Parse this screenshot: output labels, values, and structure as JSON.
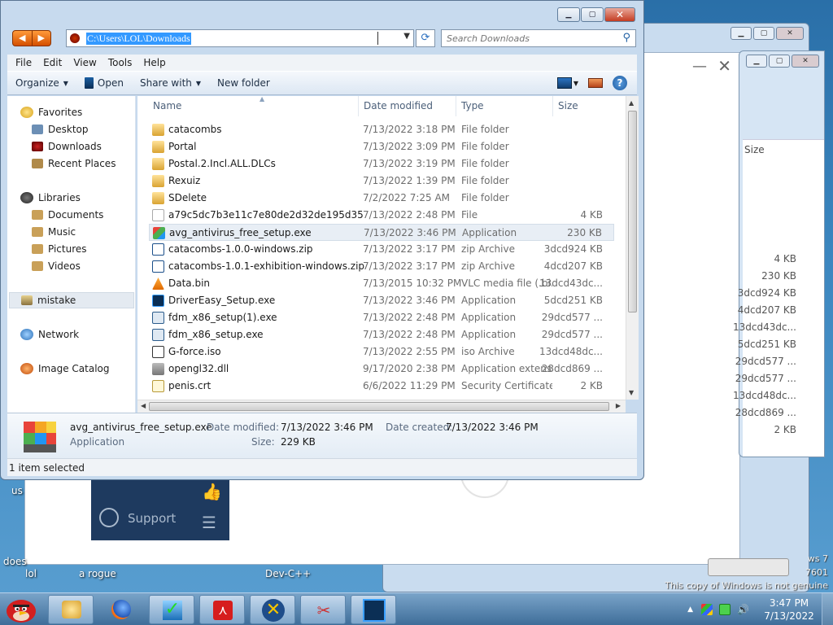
{
  "window": {
    "address_path": "C:\\Users\\LOL\\Downloads",
    "search_placeholder": "Search Downloads",
    "menu": [
      "File",
      "Edit",
      "View",
      "Tools",
      "Help"
    ],
    "commands": {
      "organize": "Organize",
      "open": "Open",
      "share_with": "Share with",
      "new_folder": "New folder"
    },
    "nav": {
      "favorites": "Favorites",
      "desktop": "Desktop",
      "downloads": "Downloads",
      "recent_places": "Recent Places",
      "libraries": "Libraries",
      "documents": "Documents",
      "music": "Music",
      "pictures": "Pictures",
      "videos": "Videos",
      "mistake": "mistake",
      "network": "Network",
      "image_catalog": "Image Catalog"
    },
    "columns": {
      "name": "Name",
      "date": "Date modified",
      "type": "Type",
      "size": "Size"
    },
    "files": [
      {
        "name": "catacombs",
        "date": "7/13/2022 3:18 PM",
        "type": "File folder",
        "size": "",
        "icon": "folder-icon"
      },
      {
        "name": "Portal",
        "date": "7/13/2022 3:09 PM",
        "type": "File folder",
        "size": "",
        "icon": "folder-icon"
      },
      {
        "name": "Postal.2.Incl.ALL.DLCs",
        "date": "7/13/2022 3:19 PM",
        "type": "File folder",
        "size": "",
        "icon": "folder-icon"
      },
      {
        "name": "Rexuiz",
        "date": "7/13/2022 1:39 PM",
        "type": "File folder",
        "size": "",
        "icon": "folder-icon"
      },
      {
        "name": "SDelete",
        "date": "7/2/2022 7:25 AM",
        "type": "File folder",
        "size": "",
        "icon": "folder-icon"
      },
      {
        "name": "a79c5dc7b3e11c7e80de2d32de195d35",
        "date": "7/13/2022 2:48 PM",
        "type": "File",
        "size": "4 KB",
        "icon": "file-icon"
      },
      {
        "name": "avg_antivirus_free_setup.exe",
        "date": "7/13/2022 3:46 PM",
        "type": "Application",
        "size": "230 KB",
        "icon": "avg-icon"
      },
      {
        "name": "catacombs-1.0.0-windows.zip",
        "date": "7/13/2022 3:17 PM",
        "type": "zip Archive",
        "size": "3dcd924 KB",
        "icon": "zip-icon"
      },
      {
        "name": "catacombs-1.0.1-exhibition-windows.zip",
        "date": "7/13/2022 3:17 PM",
        "type": "zip Archive",
        "size": "4dcd207 KB",
        "icon": "zip-icon"
      },
      {
        "name": "Data.bin",
        "date": "7/13/2015 10:32 PM",
        "type": "VLC media file (.bi...",
        "size": "13dcd43dc...",
        "icon": "vlc-icon"
      },
      {
        "name": "DriverEasy_Setup.exe",
        "date": "7/13/2022 3:46 PM",
        "type": "Application",
        "size": "5dcd251 KB",
        "icon": "drivereasy-icon"
      },
      {
        "name": "fdm_x86_setup(1).exe",
        "date": "7/13/2022 2:48 PM",
        "type": "Application",
        "size": "29dcd577 ...",
        "icon": "installer-icon"
      },
      {
        "name": "fdm_x86_setup.exe",
        "date": "7/13/2022 2:48 PM",
        "type": "Application",
        "size": "29dcd577 ...",
        "icon": "installer-icon"
      },
      {
        "name": "G-force.iso",
        "date": "7/13/2022 2:55 PM",
        "type": "iso Archive",
        "size": "13dcd48dc...",
        "icon": "iso-icon"
      },
      {
        "name": "opengl32.dll",
        "date": "9/17/2020 2:38 PM",
        "type": "Application extens...",
        "size": "28dcd869 ...",
        "icon": "dll-icon"
      },
      {
        "name": "penis.crt",
        "date": "6/6/2022 11:29 PM",
        "type": "Security Certificate",
        "size": "2 KB",
        "icon": "certificate-icon"
      }
    ],
    "details": {
      "name": "avg_antivirus_free_setup.exe",
      "kind": "Application",
      "modified_label": "Date modified:",
      "modified": "7/13/2022 3:46 PM",
      "created_label": "Date created:",
      "created": "7/13/2022 3:46 PM",
      "size_label": "Size:",
      "size": "229 KB"
    },
    "status": "1 item selected"
  },
  "background": {
    "size_header": "Size",
    "sizes": [
      "4 KB",
      "230 KB",
      "3dcd924 KB",
      "4dcd207 KB",
      "13dcd43dc...",
      "5dcd251 KB",
      "29dcd577 ...",
      "29dcd577 ...",
      "13dcd48dc...",
      "28dcd869 ...",
      "2 KB"
    ],
    "support_label": "Support"
  },
  "desktop": {
    "labels": {
      "lol": "lol",
      "rogue": "a rogue",
      "devcpp": "Dev-C++",
      "does": "does",
      "us": "us"
    },
    "watermark": [
      "ws 7",
      "7601",
      "This copy of Windows is not genuine"
    ]
  },
  "taskbar": {
    "time": "3:47 PM",
    "date": "7/13/2022"
  },
  "colors": {
    "selection": "#3399ff",
    "taskbar": "#4a78a4",
    "accent_orange": "#e56a10"
  }
}
